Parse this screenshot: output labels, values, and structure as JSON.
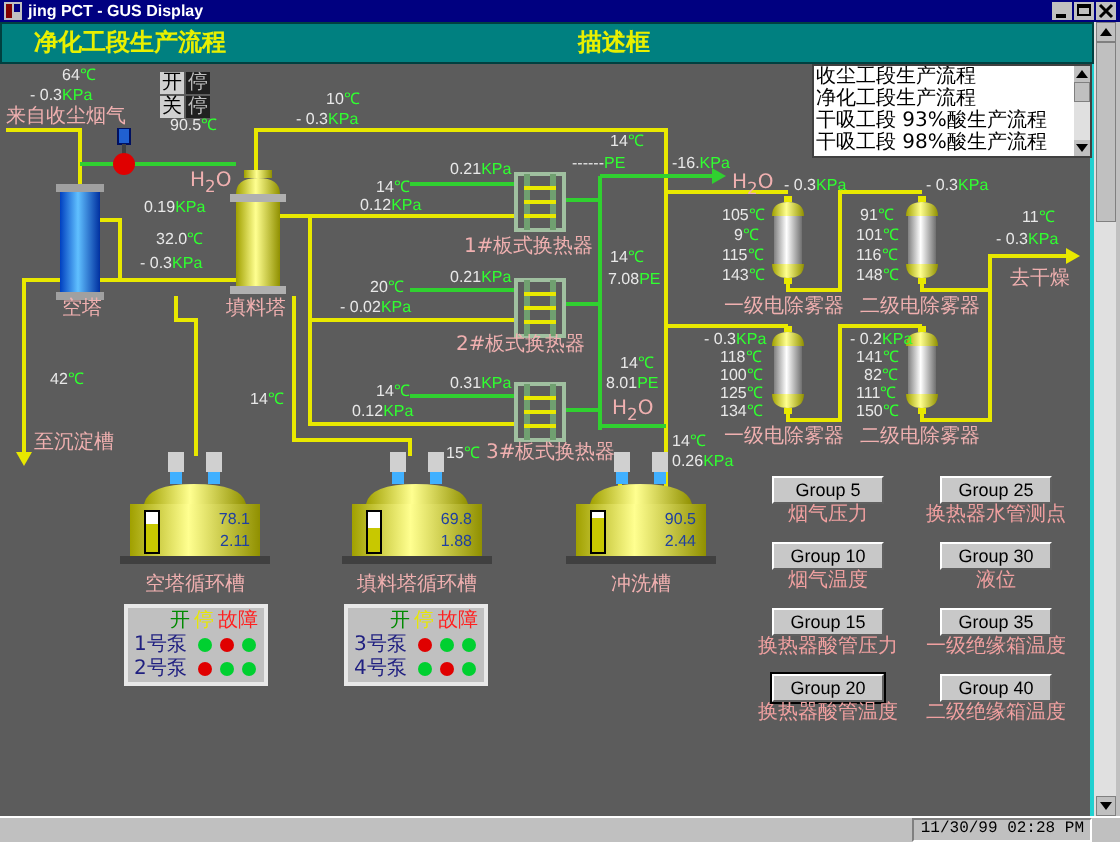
{
  "window": {
    "title": "jing PCT - GUS Display"
  },
  "header": {
    "title": "净化工段生产流程",
    "description_title": "描述框"
  },
  "description_list": {
    "items": [
      "收尘工段生产流程",
      "净化工段生产流程",
      "干吸工段 93%酸生产流程",
      "干吸工段 98%酸生产流程"
    ]
  },
  "switch_panel": [
    {
      "label": "开",
      "kind": "button"
    },
    {
      "label": "停",
      "kind": "lamp"
    },
    {
      "label": "关",
      "kind": "button"
    },
    {
      "label": "停",
      "kind": "lamp"
    }
  ],
  "readings": [
    {
      "value": "64",
      "unit": "℃"
    },
    {
      "value": "- 0.3",
      "unit": "KPa"
    },
    {
      "value": "90.5",
      "unit": "℃"
    },
    {
      "value": "10",
      "unit": "℃"
    },
    {
      "value": "- 0.3",
      "unit": "KPa"
    },
    {
      "value": "0.19",
      "unit": "KPa"
    },
    {
      "value": "32.0",
      "unit": "℃"
    },
    {
      "value": "- 0.3",
      "unit": "KPa"
    },
    {
      "value": "14",
      "unit": "℃"
    },
    {
      "value": "0.12",
      "unit": "KPa"
    },
    {
      "value": "0.21",
      "unit": "KPa"
    },
    {
      "value": "0.21",
      "unit": "KPa"
    },
    {
      "value": "20",
      "unit": "℃"
    },
    {
      "value": "- 0.02",
      "unit": "KPa"
    },
    {
      "value": "0.31",
      "unit": "KPa"
    },
    {
      "value": "14",
      "unit": "℃"
    },
    {
      "value": "0.12",
      "unit": "KPa"
    },
    {
      "value": "14",
      "unit": "℃"
    },
    {
      "value": "42",
      "unit": "℃"
    },
    {
      "value": "15",
      "unit": "℃"
    },
    {
      "value": "14",
      "unit": "℃"
    },
    {
      "value": "------",
      "unit": "PE"
    },
    {
      "value": "-16.",
      "unit": "KPa"
    },
    {
      "value": "- 0.3",
      "unit": "KPa"
    },
    {
      "value": "- 0.3",
      "unit": "KPa"
    },
    {
      "value": "105",
      "unit": "℃"
    },
    {
      "value": "9",
      "unit": "℃"
    },
    {
      "value": "115",
      "unit": "℃"
    },
    {
      "value": "143",
      "unit": "℃"
    },
    {
      "value": "91",
      "unit": "℃"
    },
    {
      "value": "101",
      "unit": "℃"
    },
    {
      "value": "116",
      "unit": "℃"
    },
    {
      "value": "148",
      "unit": "℃"
    },
    {
      "value": "11",
      "unit": "℃"
    },
    {
      "value": "- 0.3",
      "unit": "KPa"
    },
    {
      "value": "14",
      "unit": "℃"
    },
    {
      "value": "7.08",
      "unit": "PE"
    },
    {
      "value": "- 0.3",
      "unit": "KPa"
    },
    {
      "value": "118",
      "unit": "℃"
    },
    {
      "value": "100",
      "unit": "℃"
    },
    {
      "value": "125",
      "unit": "℃"
    },
    {
      "value": "134",
      "unit": "℃"
    },
    {
      "value": "- 0.2",
      "unit": "KPa"
    },
    {
      "value": "141",
      "unit": "℃"
    },
    {
      "value": "82",
      "unit": "℃"
    },
    {
      "value": "111",
      "unit": "℃"
    },
    {
      "value": "150",
      "unit": "℃"
    },
    {
      "value": "14",
      "unit": "℃"
    },
    {
      "value": "8.01",
      "unit": "PE"
    },
    {
      "value": "14",
      "unit": "℃"
    },
    {
      "value": "0.26",
      "unit": "KPa"
    }
  ],
  "labels": [
    "来自收尘烟气",
    "H$_{2}$O",
    "空塔",
    "填料塔",
    "1#板式换热器",
    "2#板式换热器",
    "3#板式换热器",
    "至沉淀槽",
    "H$_{2}$O",
    "一级电除雾器",
    "二级电除雾器",
    "去干燥",
    "H$_{2}$O",
    "一级电除雾器",
    "二级电除雾器"
  ],
  "tanks": [
    {
      "label": "空塔循环槽",
      "value": "78.1",
      "reading": "2.11",
      "level": 0.7
    },
    {
      "label": "填料塔循环槽",
      "value": "69.8",
      "reading": "1.88",
      "level": 0.6
    },
    {
      "label": "冲洗槽",
      "value": "90.5",
      "reading": "2.44",
      "level": 0.85
    }
  ],
  "pump_panels": [
    {
      "legend": [
        {
          "text": "开",
          "color": "#008a00"
        },
        {
          "text": "停",
          "color": "#e8e800"
        },
        {
          "text": "故障",
          "color": "#ff2020"
        }
      ],
      "pumps": [
        {
          "name": "1号泵",
          "lamps": [
            {
              "color": "#00d030"
            },
            {
              "color": "#e00000"
            },
            {
              "color": "#00d030"
            }
          ]
        },
        {
          "name": "2号泵",
          "lamps": [
            {
              "color": "#e00000"
            },
            {
              "color": "#00d030"
            },
            {
              "color": "#00d030"
            }
          ]
        }
      ]
    },
    {
      "legend": [
        {
          "text": "开",
          "color": "#008a00"
        },
        {
          "text": "停",
          "color": "#e8e800"
        },
        {
          "text": "故障",
          "color": "#ff2020"
        }
      ],
      "pumps": [
        {
          "name": "3号泵",
          "lamps": [
            {
              "color": "#e00000"
            },
            {
              "color": "#00d030"
            },
            {
              "color": "#00d030"
            }
          ]
        },
        {
          "name": "4号泵",
          "lamps": [
            {
              "color": "#00d030"
            },
            {
              "color": "#e00000"
            },
            {
              "color": "#00d030"
            }
          ]
        }
      ]
    }
  ],
  "groups": [
    {
      "button": "Group 5",
      "label": "烟气压力",
      "selected": false
    },
    {
      "button": "Group 25",
      "label": "换热器水管测点",
      "selected": false
    },
    {
      "button": "Group 10",
      "label": "烟气温度",
      "selected": false
    },
    {
      "button": "Group 30",
      "label": "液位",
      "selected": false
    },
    {
      "button": "Group 15",
      "label": "换热器酸管压力",
      "selected": false
    },
    {
      "button": "Group 35",
      "label": "一级绝缘箱温度",
      "selected": false
    },
    {
      "button": "Group 20",
      "label": "换热器酸管温度",
      "selected": true
    },
    {
      "button": "Group 40",
      "label": "二级绝缘箱温度",
      "selected": false
    }
  ],
  "status_bar": {
    "datetime": "11/30/99 02:28 PM"
  }
}
